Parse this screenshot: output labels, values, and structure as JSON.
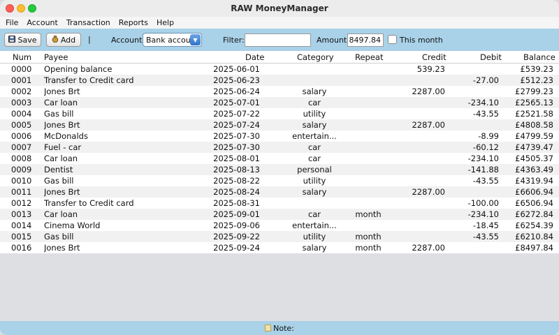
{
  "window": {
    "title": "RAW MoneyManager"
  },
  "menu": [
    "File",
    "Account",
    "Transaction",
    "Reports",
    "Help"
  ],
  "toolbar": {
    "save_label": "Save",
    "add_label": "Add",
    "separator": "|",
    "account_label": "Account:",
    "account_value": "Bank account",
    "filter_label": "Filter:",
    "filter_value": "",
    "amount_label": "Amount:",
    "amount_value": "8497.84",
    "this_month_label": "This month",
    "this_month_checked": false
  },
  "table": {
    "headers": [
      "Num",
      "Payee",
      "Date",
      "Category",
      "Repeat",
      "Credit",
      "Debit",
      "Balance"
    ],
    "rows": [
      [
        "0000",
        "Opening balance",
        "2025-06-01",
        "",
        "",
        "539.23",
        "",
        "£539.23"
      ],
      [
        "0001",
        "Transfer to Credit card",
        "2025-06-23",
        "",
        "",
        "",
        "-27.00",
        "£512.23"
      ],
      [
        "0002",
        "Jones Brt",
        "2025-06-24",
        "salary",
        "",
        "2287.00",
        "",
        "£2799.23"
      ],
      [
        "0003",
        "Car loan",
        "2025-07-01",
        "car",
        "",
        "",
        "-234.10",
        "£2565.13"
      ],
      [
        "0004",
        "Gas bill",
        "2025-07-22",
        "utility",
        "",
        "",
        "-43.55",
        "£2521.58"
      ],
      [
        "0005",
        "Jones Brt",
        "2025-07-24",
        "salary",
        "",
        "2287.00",
        "",
        "£4808.58"
      ],
      [
        "0006",
        "McDonalds",
        "2025-07-30",
        "entertain...",
        "",
        "",
        "-8.99",
        "£4799.59"
      ],
      [
        "0007",
        "Fuel - car",
        "2025-07-30",
        "car",
        "",
        "",
        "-60.12",
        "£4739.47"
      ],
      [
        "0008",
        "Car loan",
        "2025-08-01",
        "car",
        "",
        "",
        "-234.10",
        "£4505.37"
      ],
      [
        "0009",
        "Dentist",
        "2025-08-13",
        "personal",
        "",
        "",
        "-141.88",
        "£4363.49"
      ],
      [
        "0010",
        "Gas bill",
        "2025-08-22",
        "utility",
        "",
        "",
        "-43.55",
        "£4319.94"
      ],
      [
        "0011",
        "Jones Brt",
        "2025-08-24",
        "salary",
        "",
        "2287.00",
        "",
        "£6606.94"
      ],
      [
        "0012",
        "Transfer to Credit card",
        "2025-08-31",
        "",
        "",
        "",
        "-100.00",
        "£6506.94"
      ],
      [
        "0013",
        "Car loan",
        "2025-09-01",
        "car",
        "month",
        "",
        "-234.10",
        "£6272.84"
      ],
      [
        "0014",
        "Cinema World",
        "2025-09-06",
        "entertain...",
        "",
        "",
        "-18.45",
        "£6254.39"
      ],
      [
        "0015",
        "Gas bill",
        "2025-09-22",
        "utility",
        "month",
        "",
        "-43.55",
        "£6210.84"
      ],
      [
        "0016",
        "Jones Brt",
        "2025-09-24",
        "salary",
        "month",
        "2287.00",
        "",
        "£8497.84"
      ]
    ]
  },
  "status": {
    "note_label": "Note:"
  },
  "colors": {
    "toolbar_bg": "#a9d1e8",
    "status_bg": "#a9d1e8",
    "row_alt": "#f1f1f1"
  }
}
